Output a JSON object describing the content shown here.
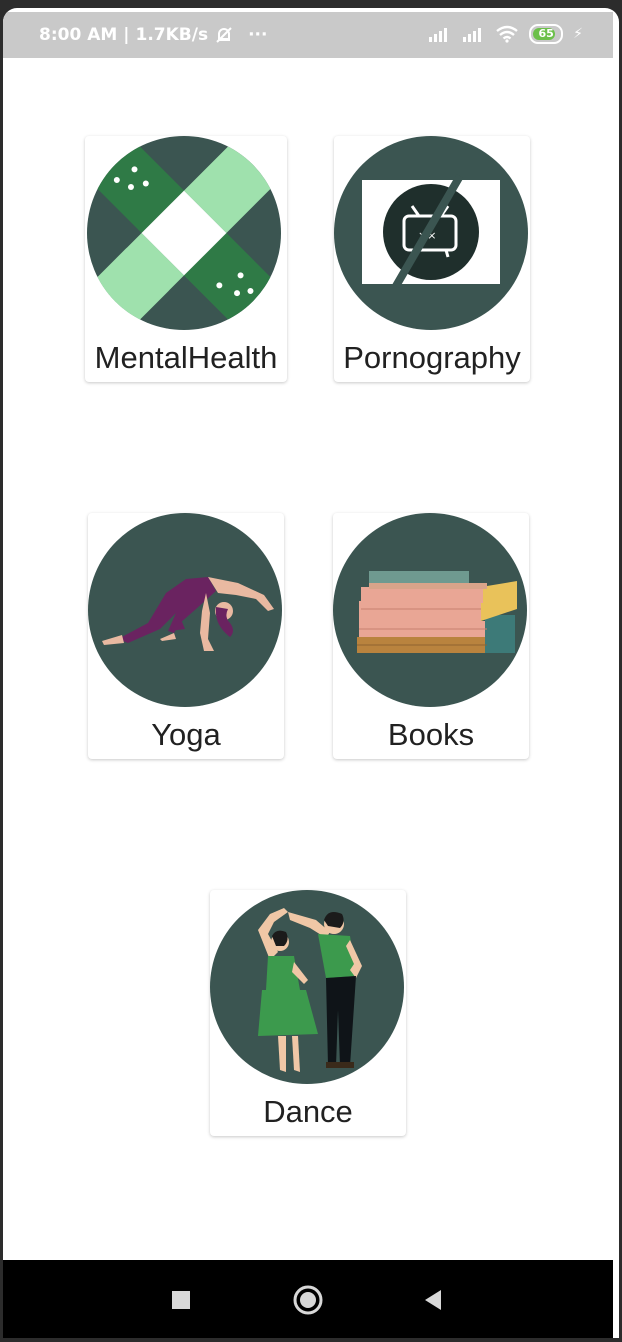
{
  "status_bar": {
    "time": "8:00 AM",
    "net_speed": "1.7KB/s",
    "more": "···",
    "battery": "65",
    "signal1": "signal-icon",
    "signal2": "signal-icon",
    "wifi": "wifi-icon",
    "mute": "bell-off-icon"
  },
  "categories": [
    {
      "label": "MentalHealth",
      "icon": "bandage-icon"
    },
    {
      "label": "Pornography",
      "icon": "no-tv-icon"
    },
    {
      "label": "Yoga",
      "icon": "yoga-pose-icon"
    },
    {
      "label": "Books",
      "icon": "books-stack-icon"
    },
    {
      "label": "Dance",
      "icon": "dancing-couple-icon"
    }
  ],
  "colors": {
    "circle_bg": "#3b5551",
    "accent_green": "#2f7a46",
    "light_green": "#9fe1ad",
    "nav_bg": "#000000"
  }
}
